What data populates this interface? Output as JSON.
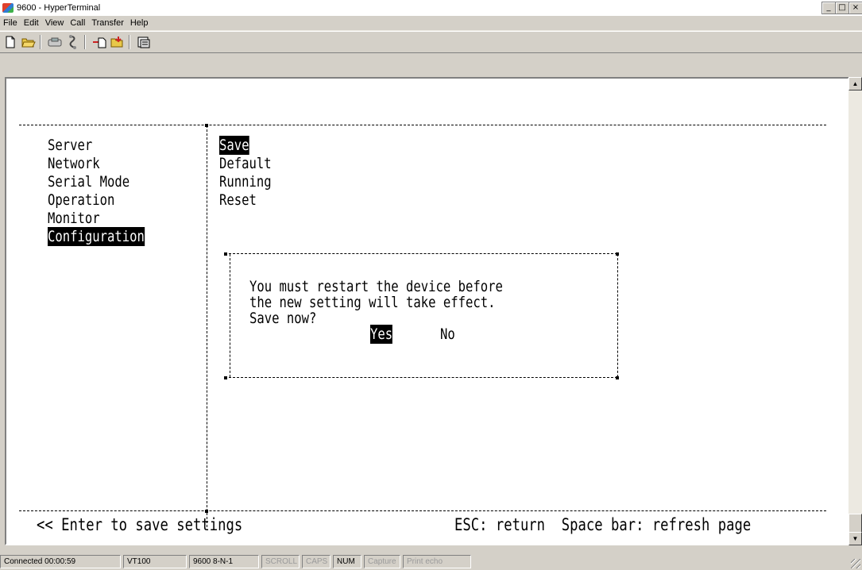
{
  "window": {
    "title": "9600 - HyperTerminal",
    "controls": [
      "_",
      "□",
      "×"
    ]
  },
  "menu": [
    {
      "label": "File"
    },
    {
      "label": "Edit"
    },
    {
      "label": "View"
    },
    {
      "label": "Call"
    },
    {
      "label": "Transfer"
    },
    {
      "label": "Help"
    }
  ],
  "toolbar": {
    "icons": [
      "new-icon",
      "open-icon",
      "disconnect-icon",
      "dial-icon",
      "send-icon",
      "receive-icon",
      "properties-icon"
    ]
  },
  "terminal": {
    "left_menu": [
      "Server",
      "Network",
      "Serial Mode",
      "Operation",
      "Monitor",
      "Configuration"
    ],
    "left_selected": "Configuration",
    "right_menu": [
      "Save",
      "Default",
      "Running",
      "Reset"
    ],
    "right_selected": "Save",
    "dialog": {
      "line1": "You must restart the device before",
      "line2": "the new setting will take effect.",
      "line3": "Save now?",
      "yes": "Yes",
      "no": "No"
    },
    "footer_left": "<< Enter to save settings",
    "footer_right": "ESC: return  Space bar: refresh page"
  },
  "statusbar": {
    "connected": "Connected 00:00:59",
    "emulation": "VT100",
    "settings": "9600 8-N-1",
    "scroll": "SCROLL",
    "caps": "CAPS",
    "num": "NUM",
    "capture": "Capture",
    "print": "Print echo"
  }
}
